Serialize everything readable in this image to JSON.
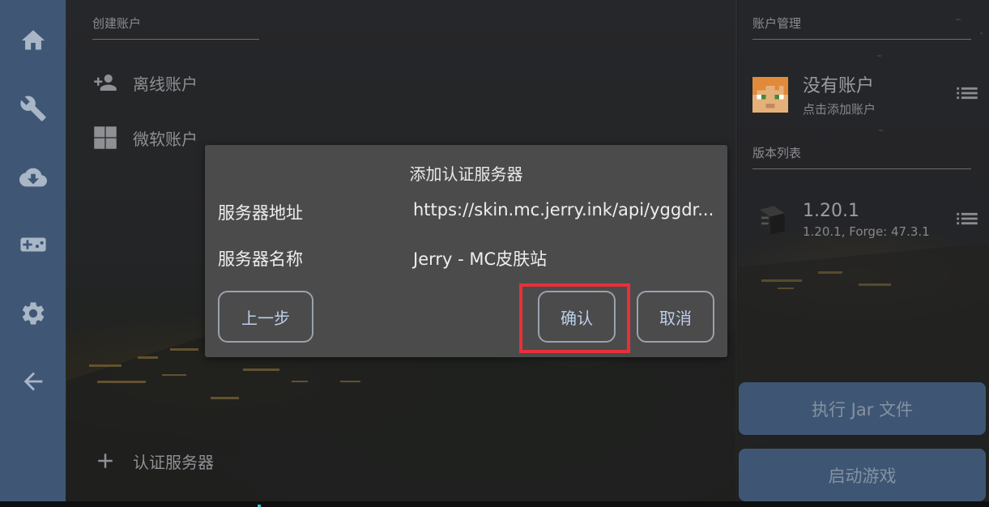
{
  "nav": {
    "items": [
      {
        "icon": "home-icon"
      },
      {
        "icon": "wrench-icon"
      },
      {
        "icon": "cloud-download-icon"
      },
      {
        "icon": "gamepad-icon"
      },
      {
        "icon": "gear-icon"
      },
      {
        "icon": "back-arrow-icon"
      }
    ]
  },
  "accounts": {
    "section_title": "创建账户",
    "items": [
      {
        "label": "离线账户",
        "icon": "add-person-icon"
      },
      {
        "label": "微软账户",
        "icon": "windows-logo-icon"
      }
    ],
    "auth_server_label": "认证服务器"
  },
  "right_panel": {
    "account_section_title": "账户管理",
    "account_main": "没有账户",
    "account_sub": "点击添加账户",
    "versions_section_title": "版本列表",
    "version_main": "1.20.1",
    "version_sub": "1.20.1, Forge: 47.3.1",
    "run_jar_label": "执行 Jar 文件",
    "launch_label": "启动游戏"
  },
  "dialog": {
    "title": "添加认证服务器",
    "address_label": "服务器地址",
    "address_value": "https://skin.mc.jerry.ink/api/yggdr...",
    "name_label": "服务器名称",
    "name_value": "Jerry - MC皮肤站",
    "prev_label": "上一步",
    "confirm_label": "确认",
    "cancel_label": "取消"
  },
  "colors": {
    "rail": "#3f5775",
    "dialog": "#4b4b4b",
    "highlight": "#e8303a",
    "button_text": "#bcd0ea"
  }
}
